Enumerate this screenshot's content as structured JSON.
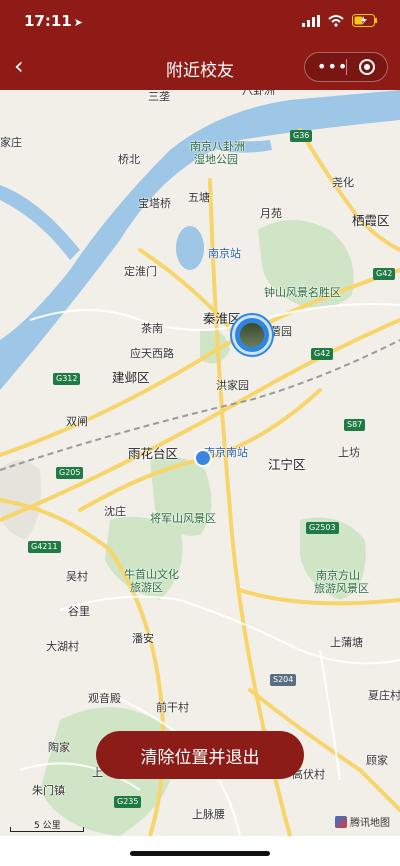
{
  "status": {
    "time": "17:11"
  },
  "nav": {
    "title": "附近校友"
  },
  "map": {
    "labels": {
      "sanyu": "三垄",
      "bagua": "八卦洲",
      "jiazhuang": "家庄",
      "qiaobei": "桥北",
      "baguazhou_park": "南京八卦洲",
      "baguazhou_park2": "湿地公园",
      "yaohua": "尧化",
      "baotaqiao": "宝塔桥",
      "wutang": "五塘",
      "yuewan": "月苑",
      "qixia": "栖霞区",
      "njzhan": "南京站",
      "dingjiaqiao": "定淮门",
      "zhongshan": "钟山风景名胜区",
      "qinhuai": "秦淮区",
      "chanan": "茶南",
      "rongyuan": "蓿园",
      "yingtian": "应天西路",
      "jianye": "建邺区",
      "hongjiayuan": "洪家园",
      "shuangzha": "双闸",
      "yuhuatai": "雨花台区",
      "njnan": "南京南站",
      "jiangning": "江宁区",
      "shangfang": "上坊",
      "shenzhuang": "沈庄",
      "jiangjunshan": "将军山风景区",
      "niushoushan": "牛首山文化",
      "niushoushan2": "旅游区",
      "fangshan": "南京方山",
      "fangshan2": "旅游风景区",
      "wucun": "吴村",
      "guli": "谷里",
      "shangputang": "上蒲塘",
      "dahucun": "大湖村",
      "panan": "潘安",
      "guanyindian": "观音殿",
      "qianganchun": "前干村",
      "xiazhuangcun": "夏庄村",
      "taojia": "陶家",
      "gucheng": "上",
      "guwa": "顾家",
      "gaofucun": "高伏村",
      "zhumenzhen": "朱门镇",
      "shangmaiyao": "上脉腰"
    },
    "roads": {
      "g36": "G36",
      "g42a": "G42",
      "g42b": "G42",
      "g312": "G312",
      "s87": "S87",
      "g205": "G205",
      "g4211": "G4211",
      "g2503": "G2503",
      "s204": "S204",
      "g235": "G235"
    },
    "scale": "5 公里",
    "provider": "腾讯地图"
  },
  "action": {
    "exit_label": "清除位置并退出"
  },
  "colors": {
    "brand": "#8f1b16"
  }
}
